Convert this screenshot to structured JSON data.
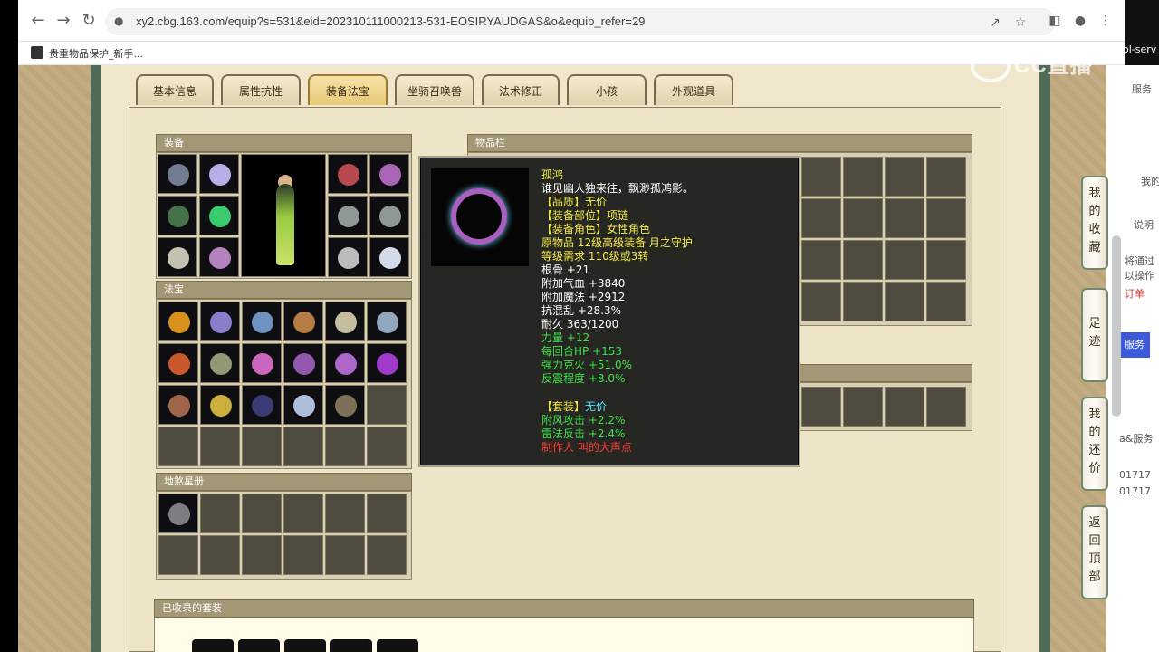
{
  "browser": {
    "url": "xy2.cbg.163.com/equip?s=531&eid=202310111000213-531-EOSIRYAUDGAS&o&equip_refer=29",
    "bookmark_label": "贵重物品保护_新手..."
  },
  "watermark": "CC直播",
  "tabs": [
    "基本信息",
    "属性抗性",
    "装备法宝",
    "坐骑召唤兽",
    "法术修正",
    "小孩",
    "外观道具"
  ],
  "active_tab": "装备法宝",
  "sections": {
    "equipment": "装备",
    "inventory": "物品栏",
    "treasure": "法宝",
    "star_book": "地煞星册",
    "collected_sets": "已收录的套装"
  },
  "tooltip": {
    "name": "孤鸿",
    "desc": "谁见幽人独来往，飘渺孤鸿影。",
    "quality": "【品质】无价",
    "slot": "【装备部位】项链",
    "role": "【装备角色】女性角色",
    "origin": "原物品 12级高级装备 月之守护",
    "requirement": "等级需求 110级或3转",
    "stats_white": [
      "根骨 +21",
      "附加气血 +3840",
      "附加魔法 +2912",
      "抗混乱 +28.3%",
      "耐久 363/1200"
    ],
    "stats_green": [
      "力量 +12",
      "每回合HP +153",
      "强力克火 +51.0%",
      "反震程度 +8.0%"
    ],
    "set_label": "【套装】",
    "set_value": "无价",
    "set_stats": [
      "附风攻击 +2.2%",
      "雷法反击 +2.4%"
    ],
    "maker": "制作人 叫的大声点"
  },
  "side_buttons": [
    {
      "label": [
        "我",
        "的",
        "收",
        "藏"
      ]
    },
    {
      "label": [
        "足",
        "迹"
      ]
    },
    {
      "label": [
        "我",
        "的",
        "还",
        "价"
      ]
    },
    {
      "label": [
        "返",
        "回",
        "顶",
        "部"
      ]
    }
  ],
  "right_sliver": {
    "t1": "ol-serv",
    "t2": "服务",
    "t3": "我的",
    "t4": "说明",
    "t5": "将通过",
    "t6": "以操作",
    "t7": "订单",
    "btn": "服务",
    "t8": "a&服务",
    "t9": "01717",
    "t10": "01717"
  },
  "colors": {
    "tooltip_title": "#f4e84a",
    "white": "#ffffff",
    "green": "#3ee04a",
    "cyan": "#4fe4ff",
    "red": "#ff3b30"
  }
}
